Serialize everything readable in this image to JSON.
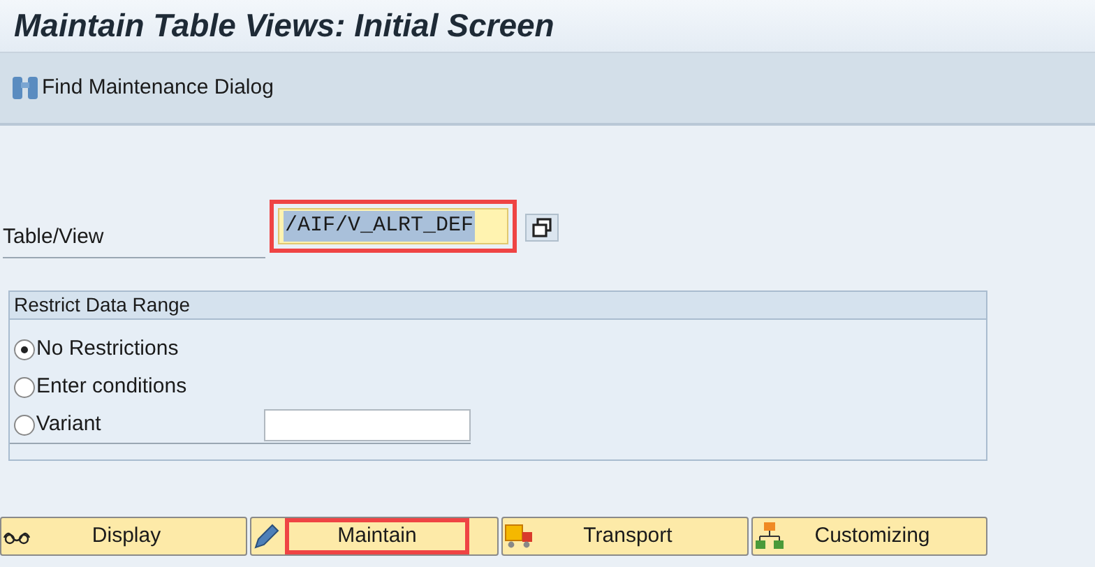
{
  "window": {
    "title": "Maintain Table Views: Initial Screen"
  },
  "toolbar": {
    "items": [
      {
        "label": "Find Maintenance Dialog"
      }
    ]
  },
  "table_view": {
    "label": "Table/View",
    "value": "/AIF/V_ALRT_DEF",
    "highlighted": true
  },
  "restrict_data_range": {
    "title": "Restrict Data Range",
    "options": [
      {
        "label": "No Restrictions",
        "selected": true
      },
      {
        "label": "Enter conditions",
        "selected": false
      },
      {
        "label": "Variant",
        "selected": false,
        "kind": "input"
      }
    ]
  },
  "buttons": [
    {
      "label": "Display",
      "kind": "display",
      "highlighted": false
    },
    {
      "label": "Maintain",
      "kind": "maintain",
      "highlighted": true
    },
    {
      "label": "Transport",
      "kind": "transport",
      "highlighted": false
    },
    {
      "label": "Customizing",
      "kind": "customizing",
      "highlighted": false
    }
  ]
}
